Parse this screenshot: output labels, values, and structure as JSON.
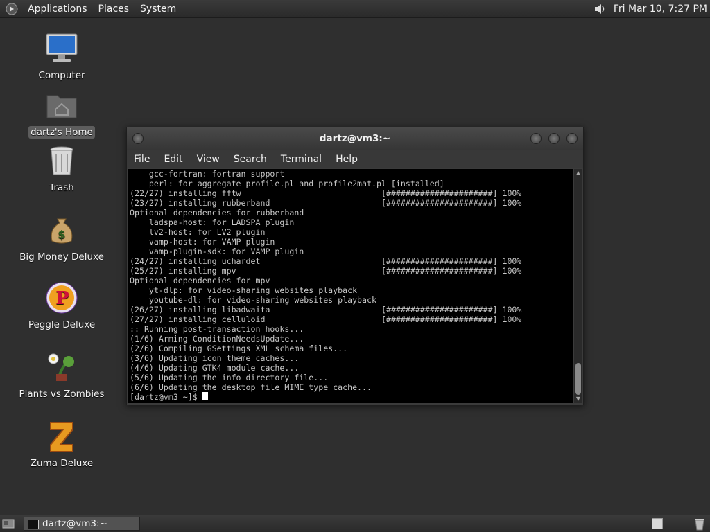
{
  "top_panel": {
    "menus": [
      "Applications",
      "Places",
      "System"
    ],
    "clock": "Fri Mar 10,  7:27 PM"
  },
  "desktop": {
    "icons": [
      {
        "label": "Computer",
        "icon": "computer-icon"
      },
      {
        "label": "dartz's Home",
        "icon": "home-folder-icon",
        "selected": true
      },
      {
        "label": "Trash",
        "icon": "trash-icon"
      },
      {
        "label": "Big Money Deluxe",
        "icon": "money-bag-icon"
      },
      {
        "label": "Peggle Deluxe",
        "icon": "peggle-icon"
      },
      {
        "label": "Plants vs Zombies",
        "icon": "plants-vs-zombies-icon"
      },
      {
        "label": "Zuma Deluxe",
        "icon": "zuma-icon"
      }
    ]
  },
  "terminal": {
    "title": "dartz@vm3:~",
    "menu": [
      "File",
      "Edit",
      "View",
      "Search",
      "Terminal",
      "Help"
    ],
    "lines": [
      "    gcc-fortran: fortran support",
      "    perl: for aggregate_profile.pl and profile2mat.pl [installed]",
      "(22/27) installing fftw                             [######################] 100%",
      "(23/27) installing rubberband                       [######################] 100%",
      "Optional dependencies for rubberband",
      "    ladspa-host: for LADSPA plugin",
      "    lv2-host: for LV2 plugin",
      "    vamp-host: for VAMP plugin",
      "    vamp-plugin-sdk: for VAMP plugin",
      "(24/27) installing uchardet                         [######################] 100%",
      "(25/27) installing mpv                              [######################] 100%",
      "Optional dependencies for mpv",
      "    yt-dlp: for video-sharing websites playback",
      "    youtube-dl: for video-sharing websites playback",
      "(26/27) installing libadwaita                       [######################] 100%",
      "(27/27) installing celluloid                        [######################] 100%",
      ":: Running post-transaction hooks...",
      "(1/6) Arming ConditionNeedsUpdate...",
      "(2/6) Compiling GSettings XML schema files...",
      "(3/6) Updating icon theme caches...",
      "(4/6) Updating GTK4 module cache...",
      "(5/6) Updating the info directory file...",
      "(6/6) Updating the desktop file MIME type cache..."
    ],
    "prompt": "[dartz@vm3 ~]$ "
  },
  "bottom_panel": {
    "task_label": "dartz@vm3:~"
  }
}
